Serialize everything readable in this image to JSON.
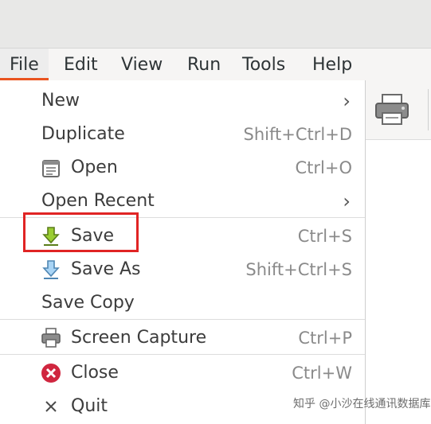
{
  "menubar": {
    "items": [
      {
        "label": "File"
      },
      {
        "label": "Edit"
      },
      {
        "label": "View"
      },
      {
        "label": "Run"
      },
      {
        "label": "Tools"
      },
      {
        "label": "Help"
      }
    ]
  },
  "file_menu": {
    "items": [
      {
        "label": "New",
        "shortcut": "",
        "submenu_arrow": "›",
        "icon": ""
      },
      {
        "label": "Duplicate",
        "shortcut": "Shift+Ctrl+D",
        "icon": ""
      },
      {
        "label": "Open",
        "shortcut": "Ctrl+O",
        "icon": "document-open-icon"
      },
      {
        "label": "Open Recent",
        "shortcut": "",
        "submenu_arrow": "›",
        "icon": ""
      },
      {
        "label": "Save",
        "shortcut": "Ctrl+S",
        "icon": "save-arrow-icon"
      },
      {
        "label": "Save As",
        "shortcut": "Shift+Ctrl+S",
        "icon": "save-as-arrow-icon"
      },
      {
        "label": "Save Copy",
        "shortcut": "",
        "icon": ""
      },
      {
        "label": "Screen Capture",
        "shortcut": "Ctrl+P",
        "icon": "printer-icon"
      },
      {
        "label": "Close",
        "shortcut": "Ctrl+W",
        "icon": "close-circle-icon"
      },
      {
        "label": "Quit",
        "shortcut": "",
        "icon": "x-icon"
      }
    ]
  },
  "toolbar": {
    "icon": "printer-icon"
  },
  "watermark": "知乎 @小沙在线通讯数据库",
  "colors": {
    "accent": "#e95420",
    "highlight_box": "#e02424",
    "save_icon": "#9acd32",
    "save_as_icon": "#7fb8e6",
    "close_icon": "#d0263f"
  }
}
